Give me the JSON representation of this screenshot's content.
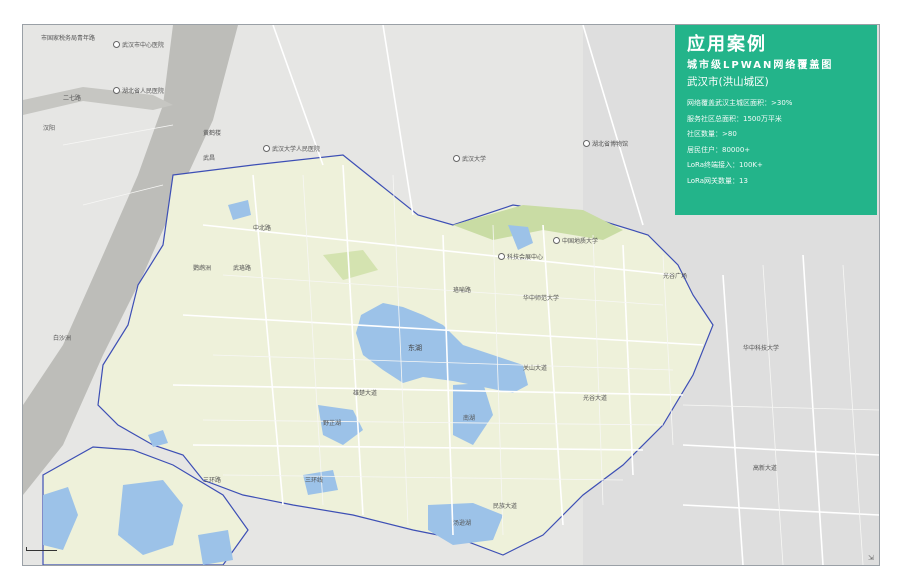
{
  "panel": {
    "title": "应用案例",
    "subtitle": "城市级LPWAN网络覆盖图",
    "district": "武汉市(洪山城区)",
    "stats": [
      "网络覆盖武汉主城区面积：>30%",
      "服务社区总面积：1500万平米",
      "社区数量：>80",
      "居民住户：80000+",
      "LoRa终端接入：100K+",
      "LoRa网关数量：13"
    ]
  },
  "map_labels": {
    "l1": "市国家税务局青年路",
    "l2": "武汉市中心医院",
    "l3": "华中科技大学",
    "l4": "湖北省人民医院",
    "l5": "武汉大学人民医院",
    "l6": "二七路",
    "l7": "黄鹤楼",
    "l8": "武汉大学",
    "l9": "湖北省博物馆",
    "l10": "中国地质大学",
    "l11": "科技会展中心",
    "l12": "光谷广场",
    "l13": "东湖",
    "l14": "南湖",
    "l15": "野芷湖",
    "l16": "三环线",
    "l17": "珞喻路",
    "l18": "雄楚大道",
    "l19": "白沙洲",
    "l20": "鹦鹉洲",
    "l21": "武昌",
    "l22": "汉阳",
    "l23": "汤逊湖",
    "l24": "关山大道",
    "l25": "光谷大道",
    "l26": "民族大道",
    "l27": "中北路",
    "l28": "武珞路",
    "l29": "高新大道",
    "l30": "三环路",
    "l31": "华中师范大学"
  },
  "colors": {
    "panel_bg": "#23b48a",
    "coverage_fill": "#eef1da",
    "coverage_border": "#3d4fb5",
    "water": "#9cc2e8",
    "river": "#b8b8b4",
    "land": "#e9e9e7",
    "road": "#ffffff"
  },
  "icons": {
    "poi": "poi-dot-icon",
    "scale": "scale-bar-icon"
  }
}
